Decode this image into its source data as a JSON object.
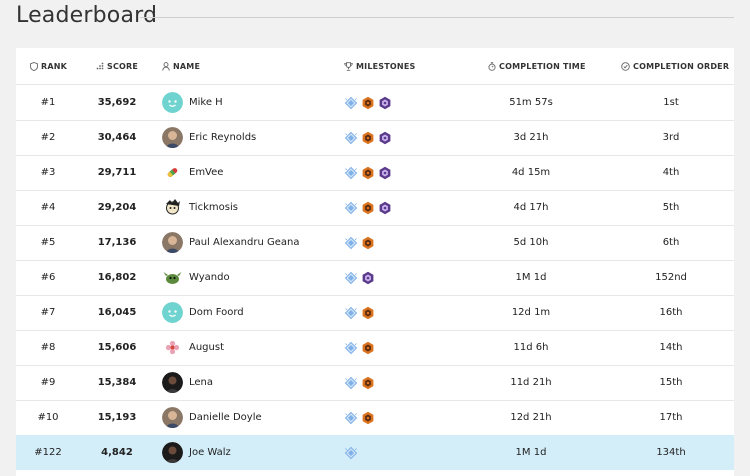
{
  "page": {
    "title": "Leaderboard"
  },
  "columns": {
    "rank": "RANK",
    "score": "SCORE",
    "name": "NAME",
    "milestones": "MILESTONES",
    "completion_time": "COMPLETION TIME",
    "completion_order": "COMPLETION ORDER"
  },
  "rows": [
    {
      "rank": "#1",
      "score": "35,692",
      "name": "Mike H",
      "avatar": "teal-smiley-avatar",
      "milestones": [
        "diamond",
        "hexagon-orange",
        "hexagon-purple"
      ],
      "time": "51m 57s",
      "order": "1st"
    },
    {
      "rank": "#2",
      "score": "30,464",
      "name": "Eric Reynolds",
      "avatar": "photo-avatar",
      "milestones": [
        "diamond",
        "hexagon-orange",
        "hexagon-purple"
      ],
      "time": "3d 21h",
      "order": "3rd"
    },
    {
      "rank": "#3",
      "score": "29,711",
      "name": "EmVee",
      "avatar": "rainbow-pill-avatar",
      "milestones": [
        "diamond",
        "hexagon-orange",
        "hexagon-purple"
      ],
      "time": "4d 15m",
      "order": "4th"
    },
    {
      "rank": "#4",
      "score": "29,204",
      "name": "Tickmosis",
      "avatar": "cartoon-avatar",
      "milestones": [
        "diamond",
        "hexagon-orange",
        "hexagon-purple"
      ],
      "time": "4d 17h",
      "order": "5th"
    },
    {
      "rank": "#5",
      "score": "17,136",
      "name": "Paul Alexandru Geana",
      "avatar": "photo-avatar",
      "milestones": [
        "diamond",
        "hexagon-orange"
      ],
      "time": "5d 10h",
      "order": "6th"
    },
    {
      "rank": "#6",
      "score": "16,802",
      "name": "Wyando",
      "avatar": "green-creature-avatar",
      "milestones": [
        "diamond",
        "hexagon-purple"
      ],
      "time": "1M 1d",
      "order": "152nd"
    },
    {
      "rank": "#7",
      "score": "16,045",
      "name": "Dom Foord",
      "avatar": "teal-smiley-avatar",
      "milestones": [
        "diamond",
        "hexagon-orange"
      ],
      "time": "12d 1m",
      "order": "16th"
    },
    {
      "rank": "#8",
      "score": "15,606",
      "name": "August",
      "avatar": "flower-avatar",
      "milestones": [
        "diamond",
        "hexagon-orange"
      ],
      "time": "11d 6h",
      "order": "14th"
    },
    {
      "rank": "#9",
      "score": "15,384",
      "name": "Lena",
      "avatar": "dark-photo-avatar",
      "milestones": [
        "diamond",
        "hexagon-orange"
      ],
      "time": "11d 21h",
      "order": "15th"
    },
    {
      "rank": "#10",
      "score": "15,193",
      "name": "Danielle Doyle",
      "avatar": "photo-avatar",
      "milestones": [
        "diamond",
        "hexagon-orange"
      ],
      "time": "12d 21h",
      "order": "17th"
    },
    {
      "rank": "#122",
      "score": "4,842",
      "name": "Joe Walz",
      "avatar": "dark-photo-avatar",
      "milestones": [
        "diamond"
      ],
      "time": "1M 1d",
      "order": "134th",
      "current_user": true
    }
  ],
  "colors": {
    "background": "#f1f1f1",
    "highlight": "#d3eef9",
    "teal": "#6fd3d0",
    "orange": "#d9731f",
    "purple": "#5b3a8c",
    "diamond": "#7fb0e8"
  }
}
